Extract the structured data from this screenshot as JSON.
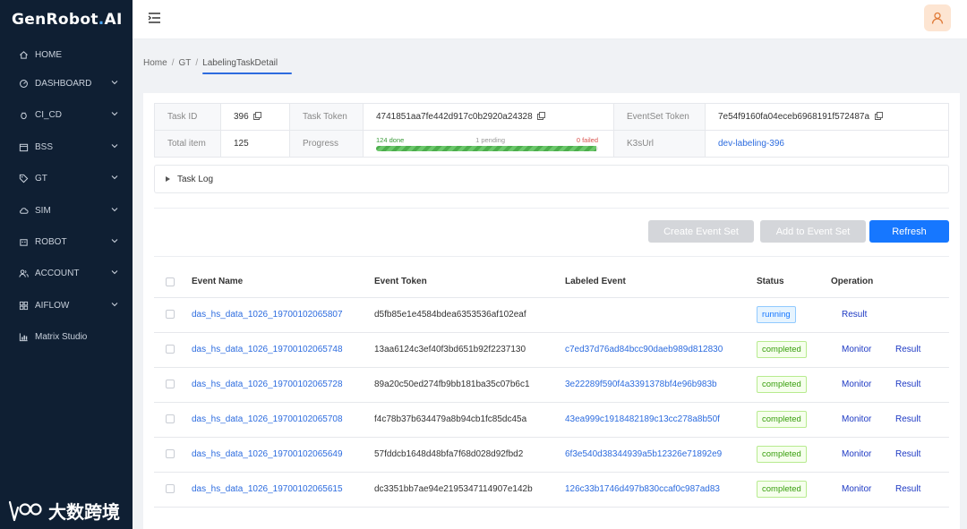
{
  "sidebar": {
    "logo": {
      "part1": "G",
      "part2": "en",
      "part3": "Robot",
      "part4": ".",
      "part5": "AI"
    },
    "items": [
      {
        "label": "HOME",
        "icon": "home-icon",
        "has_chevron": false
      },
      {
        "label": "DASHBOARD",
        "icon": "dashboard-icon",
        "has_chevron": true
      },
      {
        "label": "CI_CD",
        "icon": "bug-icon",
        "has_chevron": true
      },
      {
        "label": "BSS",
        "icon": "calendar-icon",
        "has_chevron": true
      },
      {
        "label": "GT",
        "icon": "tag-icon",
        "has_chevron": true
      },
      {
        "label": "SIM",
        "icon": "cloud-icon",
        "has_chevron": true
      },
      {
        "label": "ROBOT",
        "icon": "robot-icon",
        "has_chevron": true
      },
      {
        "label": "ACCOUNT",
        "icon": "users-icon",
        "has_chevron": true
      },
      {
        "label": "AIFLOW",
        "icon": "grid-icon",
        "has_chevron": true
      },
      {
        "label": "Matrix Studio",
        "icon": "chart-icon",
        "has_chevron": false
      }
    ],
    "watermark": "大数跨境"
  },
  "breadcrumb": {
    "home": "Home",
    "gt": "GT",
    "current": "LabelingTaskDetail",
    "sep": "/"
  },
  "info": {
    "task_id_label": "Task ID",
    "task_id": "396",
    "task_token_label": "Task Token",
    "task_token": "4741851aa7fe442d917c0b2920a24328",
    "eventset_token_label": "EventSet Token",
    "eventset_token": "7e54f9160fa04eceb6968191f572487a",
    "total_item_label": "Total item",
    "total_item": "125",
    "progress_label": "Progress",
    "progress_done": "124 done",
    "progress_pending": "1 pending",
    "progress_failed": "0 failed",
    "progress_fraction": 0.992,
    "k3s_label": "K3sUrl",
    "k3s_url": "dev-labeling-396"
  },
  "task_log": {
    "label": "Task Log"
  },
  "buttons": {
    "create": "Create Event Set",
    "add": "Add to Event Set",
    "refresh": "Refresh"
  },
  "events": {
    "headers": {
      "name": "Event Name",
      "token": "Event Token",
      "labeled": "Labeled Event",
      "status": "Status",
      "operation": "Operation"
    },
    "rows": [
      {
        "name": "das_hs_data_1026_19700102065807",
        "token": "d5fb85e1e4584bdea6353536af102eaf",
        "labeled": "",
        "status": "running",
        "monitor": "",
        "result": "Result"
      },
      {
        "name": "das_hs_data_1026_19700102065748",
        "token": "13aa6124c3ef40f3bd651b92f2237130",
        "labeled": "c7ed37d76ad84bcc90daeb989d812830",
        "status": "completed",
        "monitor": "Monitor",
        "result": "Result"
      },
      {
        "name": "das_hs_data_1026_19700102065728",
        "token": "89a20c50ed274fb9bb181ba35c07b6c1",
        "labeled": "3e22289f590f4a3391378bf4e96b983b",
        "status": "completed",
        "monitor": "Monitor",
        "result": "Result"
      },
      {
        "name": "das_hs_data_1026_19700102065708",
        "token": "f4c78b37b634479a8b94cb1fc85dc45a",
        "labeled": "43ea999c1918482189c13cc278a8b50f",
        "status": "completed",
        "monitor": "Monitor",
        "result": "Result"
      },
      {
        "name": "das_hs_data_1026_19700102065649",
        "token": "57fddcb1648d48bfa7f68d028d92fbd2",
        "labeled": "6f3e540d38344939a5b12326e71892e9",
        "status": "completed",
        "monitor": "Monitor",
        "result": "Result"
      },
      {
        "name": "das_hs_data_1026_19700102065615",
        "token": "dc3351bb7ae94e2195347114907e142b",
        "labeled": "126c33b1746d497b830ccaf0c987ad83",
        "status": "completed",
        "monitor": "Monitor",
        "result": "Result"
      }
    ]
  },
  "colors": {
    "sidebar_bg": "#0f1f33",
    "primary": "#1677ff",
    "link": "#2d6cdf",
    "success": "#389e0d"
  }
}
